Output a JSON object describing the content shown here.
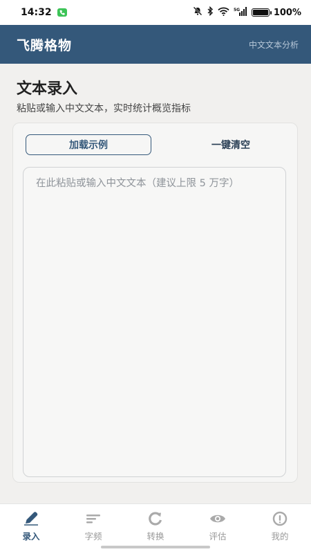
{
  "status_bar": {
    "time": "14:32",
    "battery": "100%",
    "signal": "5G"
  },
  "app_bar": {
    "title": "飞腾格物",
    "subtitle": "中文文本分析"
  },
  "page": {
    "title": "文本录入",
    "description": "粘贴或输入中文文本，实时统计概览指标"
  },
  "card": {
    "load_example_label": "加载示例",
    "clear_label": "一键清空",
    "textarea_placeholder": "在此粘贴或输入中文文本（建议上限 5 万字）",
    "textarea_value": ""
  },
  "bottom_nav": {
    "items": [
      {
        "label": "录入",
        "icon": "pencil-icon",
        "active": true
      },
      {
        "label": "字频",
        "icon": "lines-icon",
        "active": false
      },
      {
        "label": "转换",
        "icon": "refresh-icon",
        "active": false
      },
      {
        "label": "评估",
        "icon": "eye-icon",
        "active": false
      },
      {
        "label": "我的",
        "icon": "info-icon",
        "active": false
      }
    ]
  },
  "colors": {
    "primary": "#34587a",
    "background": "#f1f0ee",
    "inactive": "#999999"
  }
}
